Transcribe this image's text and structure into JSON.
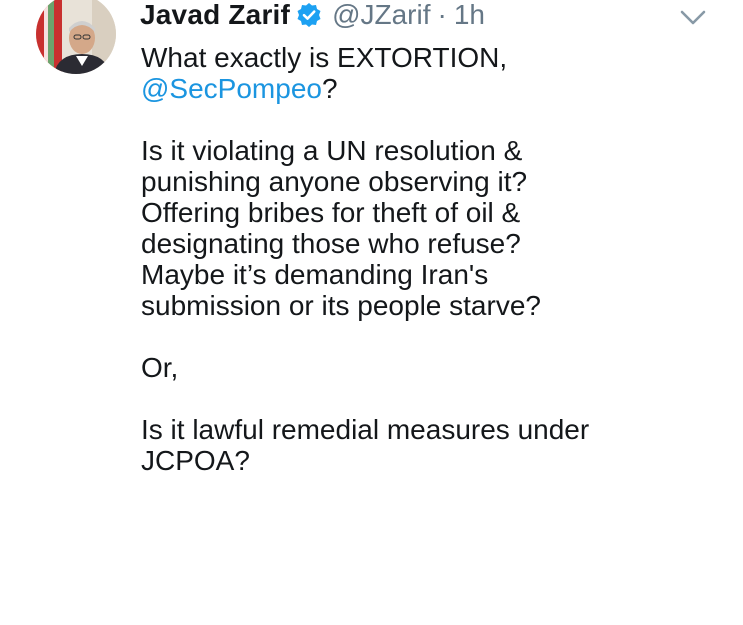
{
  "tweet": {
    "author": {
      "display_name": "Javad Zarif",
      "verified": true,
      "handle": "@JZarif",
      "separator": "·",
      "time": "1h"
    },
    "avatar_icon": "avatar",
    "menu_icon": "chevron-down-icon",
    "body": {
      "line1": "What exactly is EXTORTION,",
      "mention": "@SecPompeo",
      "mention_suffix": "?",
      "para2": [
        "Is it violating a UN resolution &",
        "punishing anyone observing it?",
        "Offering bribes for theft of oil &",
        "designating those who refuse?",
        "Maybe it’s demanding Iran's",
        "submission or its people starve?"
      ],
      "para3": "Or,",
      "para4": [
        "Is it lawful remedial measures under",
        "JCPOA?"
      ]
    },
    "colors": {
      "link": "#1b95e0",
      "verified_badge": "#1da1f2",
      "secondary_text": "#657786"
    }
  }
}
